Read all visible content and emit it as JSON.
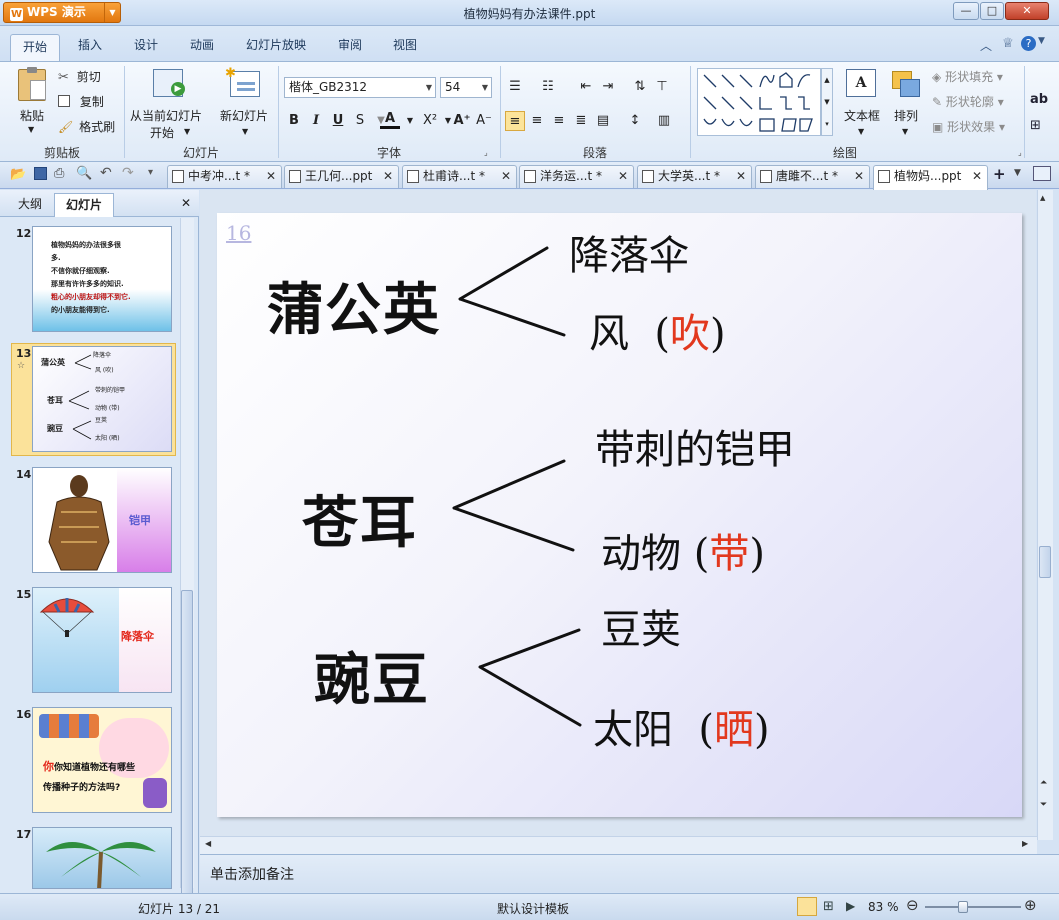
{
  "app": {
    "name": "WPS 演示",
    "title": "植物妈妈有办法课件.ppt"
  },
  "window_buttons": {
    "minimize": "—",
    "maximize": "□",
    "close": "✕"
  },
  "menu": {
    "tabs": [
      "开始",
      "插入",
      "设计",
      "动画",
      "幻灯片放映",
      "审阅",
      "视图"
    ]
  },
  "ribbon": {
    "clipboard": {
      "paste": "粘贴",
      "cut": "剪切",
      "copy": "复制",
      "format_painter": "格式刷",
      "group": "剪贴板"
    },
    "slides": {
      "from_current_1": "从当前幻灯片",
      "from_current_2": "开始",
      "new_slide": "新幻灯片",
      "group": "幻灯片"
    },
    "font": {
      "name": "楷体_GB2312",
      "size": "54",
      "group": "字体"
    },
    "paragraph": {
      "group": "段落"
    },
    "drawing": {
      "textbox": "文本框",
      "arrange": "排列",
      "fill": "形状填充",
      "outline": "形状轮廓",
      "effect": "形状效果",
      "group": "绘图"
    }
  },
  "doc_tabs": [
    {
      "label": "中考冲...t *"
    },
    {
      "label": "王几何...ppt"
    },
    {
      "label": "杜甫诗...t *"
    },
    {
      "label": "洋务运...t *"
    },
    {
      "label": "大学英...t *"
    },
    {
      "label": "唐雎不...t *"
    },
    {
      "label": "植物妈...ppt"
    }
  ],
  "left_panel": {
    "tabs": [
      "大纲",
      "幻灯片"
    ],
    "thumbs": [
      {
        "num": "12",
        "lines": [
          "植物妈妈的办法很多很",
          "多.",
          "不信你就仔细观察.",
          "那里有许许多多的知识.",
          "粗心的小朋友却得不到它.",
          "的小朋友能得到它."
        ]
      },
      {
        "num": "13",
        "items": [
          "蒲公英",
          "降落伞",
          "风 (吹)",
          "苍耳",
          "带刺的铠甲",
          "动物 (带)",
          "豌豆",
          "豆荚",
          "太阳 (晒)"
        ]
      },
      {
        "num": "14",
        "label": "铠甲"
      },
      {
        "num": "15",
        "label": "降落伞"
      },
      {
        "num": "16",
        "line1": "你知道植物还有哪些",
        "line2": "传播种子的方法吗?"
      },
      {
        "num": "17"
      }
    ]
  },
  "slide": {
    "number": "16",
    "rows": [
      {
        "main": "蒲公英",
        "top": "降落伞",
        "bottom_text": "风",
        "bottom_verb": "吹"
      },
      {
        "main": "苍耳",
        "top": "带刺的铠甲",
        "bottom_text": "动物",
        "bottom_verb": "带"
      },
      {
        "main": "豌豆",
        "top": "豆荚",
        "bottom_text": "太阳",
        "bottom_verb": "晒"
      }
    ]
  },
  "notes": {
    "placeholder": "单击添加备注"
  },
  "status": {
    "slide_info": "幻灯片 13 / 21",
    "template": "默认设计模板",
    "zoom": "83 %"
  }
}
